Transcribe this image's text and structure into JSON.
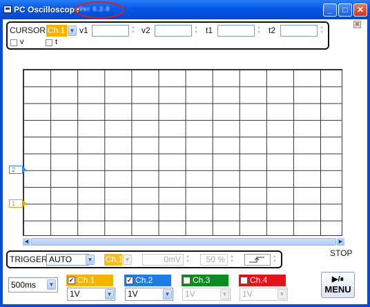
{
  "window": {
    "title": "PC Oscilloscope",
    "version": "Ver 0.2.0",
    "minimize": "_",
    "maximize": "□",
    "close": "✕"
  },
  "cursor": {
    "label": "CURSOR",
    "channel": "Ch.1",
    "v1_label": "v1",
    "v2_label": "v2",
    "t1_label": "t1",
    "t2_label": "t2",
    "v1_value": "",
    "v2_value": "",
    "t1_value": "",
    "t2_value": "",
    "check_v": "v",
    "check_t": "t"
  },
  "markers": {
    "ch2": "2",
    "ch1": "1"
  },
  "status": "STOP",
  "trigger": {
    "label": "TRIGGER",
    "mode": "AUTO",
    "channel": "Ch.1",
    "level": "0mV",
    "position": "50 %",
    "edge_icon": "rising-edge-icon"
  },
  "timebase": "500ms",
  "channels": [
    {
      "name": "Ch.1",
      "checked": true,
      "volts": "1V",
      "color": "#f5b300"
    },
    {
      "name": "Ch.2",
      "checked": true,
      "volts": "1V",
      "color": "#1f7be8"
    },
    {
      "name": "Ch.3",
      "checked": false,
      "volts": "1V",
      "color": "#0f8a1f"
    },
    {
      "name": "Ch.4",
      "checked": false,
      "volts": "1V",
      "color": "#e4131b"
    }
  ],
  "menu": {
    "icon_text": "▶/⏸",
    "label": "MENU"
  }
}
